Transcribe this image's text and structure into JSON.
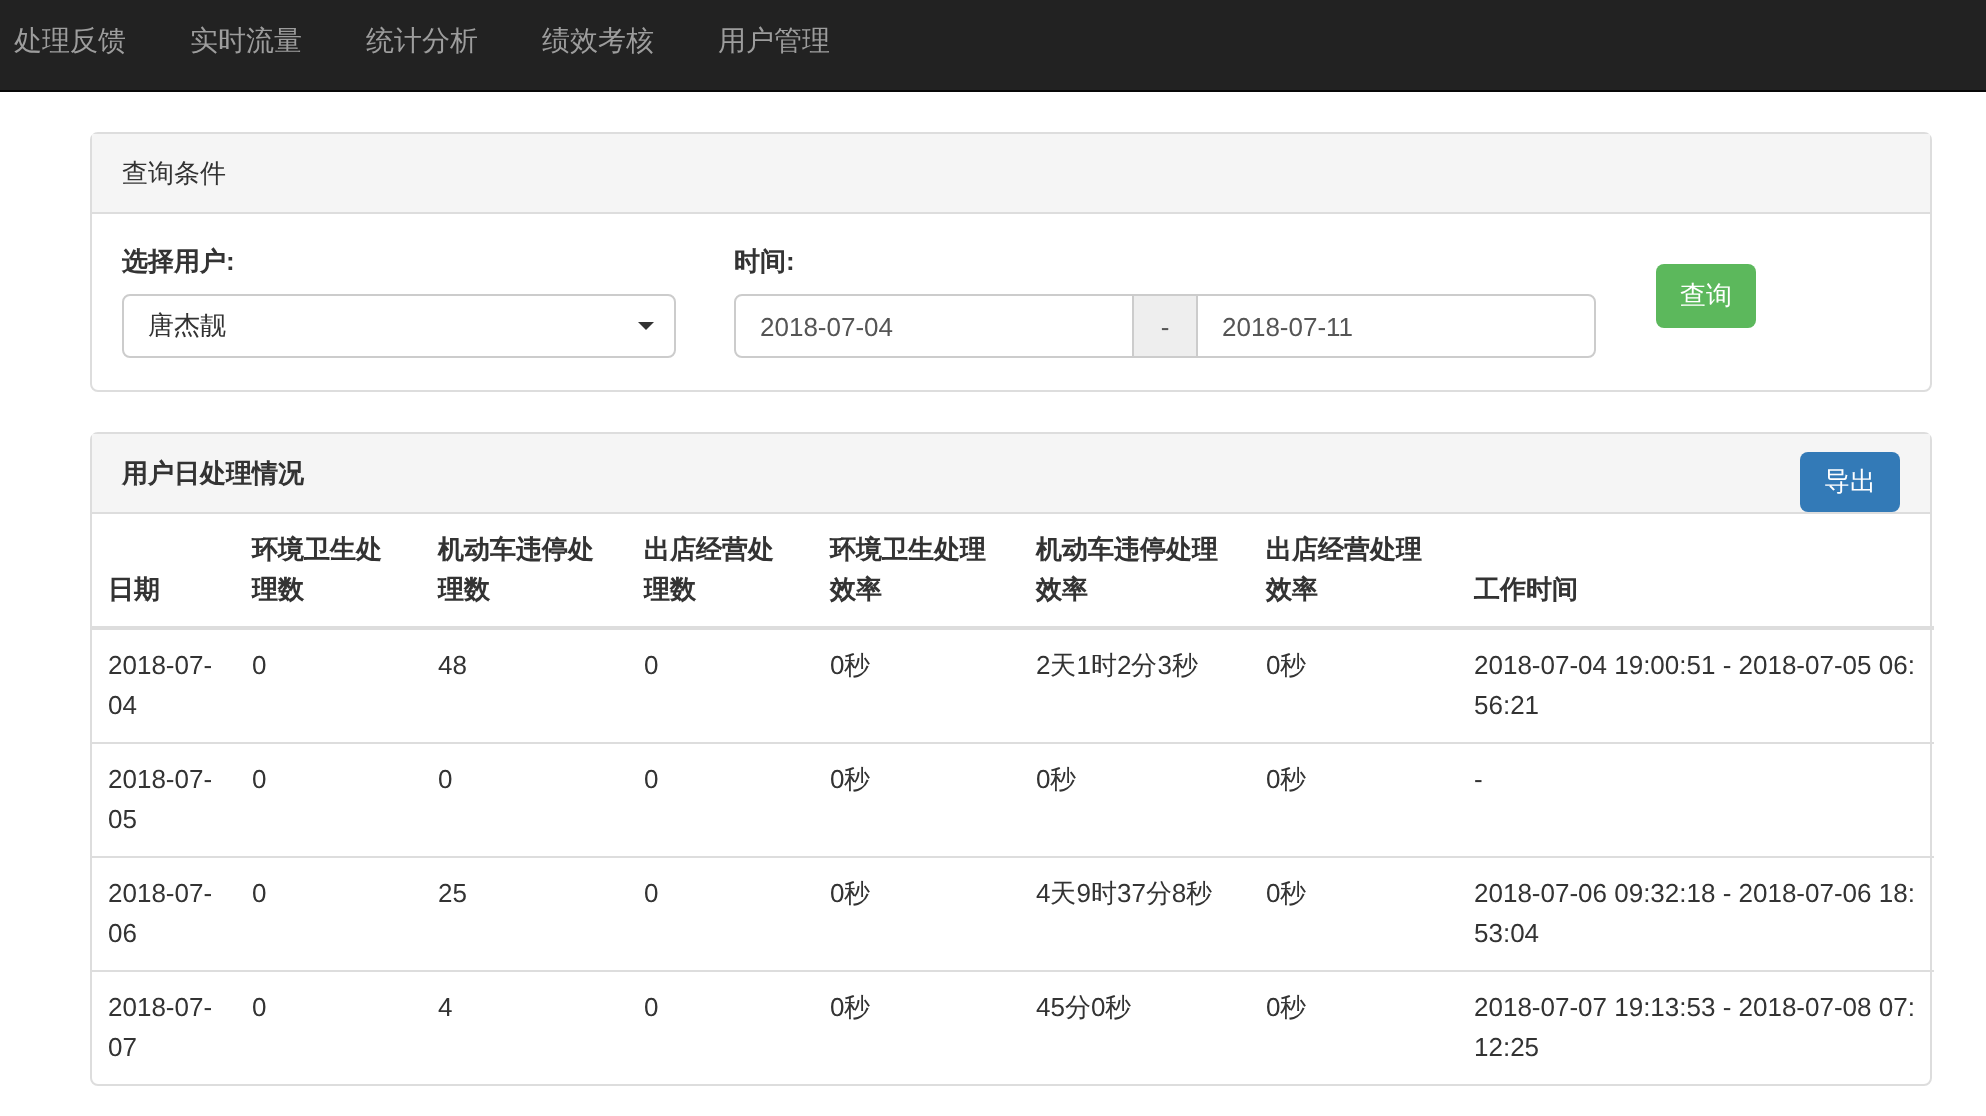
{
  "nav": {
    "items": [
      {
        "label": "处理反馈",
        "selected": false
      },
      {
        "label": "实时流量",
        "selected": false
      },
      {
        "label": "统计分析",
        "selected": false
      },
      {
        "label": "绩效考核",
        "selected": false
      },
      {
        "label": "用户管理",
        "selected": false
      }
    ]
  },
  "query_panel": {
    "title": "查询条件",
    "user_label": "选择用户:",
    "user_value": "唐杰靓",
    "time_label": "时间:",
    "start_date": "2018-07-04",
    "separator": "-",
    "end_date": "2018-07-11",
    "submit_button": "查询"
  },
  "table_panel": {
    "title": "用户日处理情况",
    "export_button": "导出",
    "columns": [
      "日期",
      "环境卫生处理数",
      "机动车违停处理数",
      "出店经营处理数",
      "环境卫生处理效率",
      "机动车违停处理效率",
      "出店经营处理效率",
      "工作时间"
    ],
    "rows": [
      [
        "2018-07-04",
        "0",
        "48",
        "0",
        "0秒",
        "2天1时2分3秒",
        "0秒",
        "2018-07-04 19:00:51 - 2018-07-05 06:56:21"
      ],
      [
        "2018-07-05",
        "0",
        "0",
        "0",
        "0秒",
        "0秒",
        "0秒",
        "-"
      ],
      [
        "2018-07-06",
        "0",
        "25",
        "0",
        "0秒",
        "4天9时37分8秒",
        "0秒",
        "2018-07-06 09:32:18 - 2018-07-06 18:53:04"
      ],
      [
        "2018-07-07",
        "0",
        "4",
        "0",
        "0秒",
        "45分0秒",
        "0秒",
        "2018-07-07 19:13:53 - 2018-07-08 07:12:25"
      ]
    ]
  }
}
